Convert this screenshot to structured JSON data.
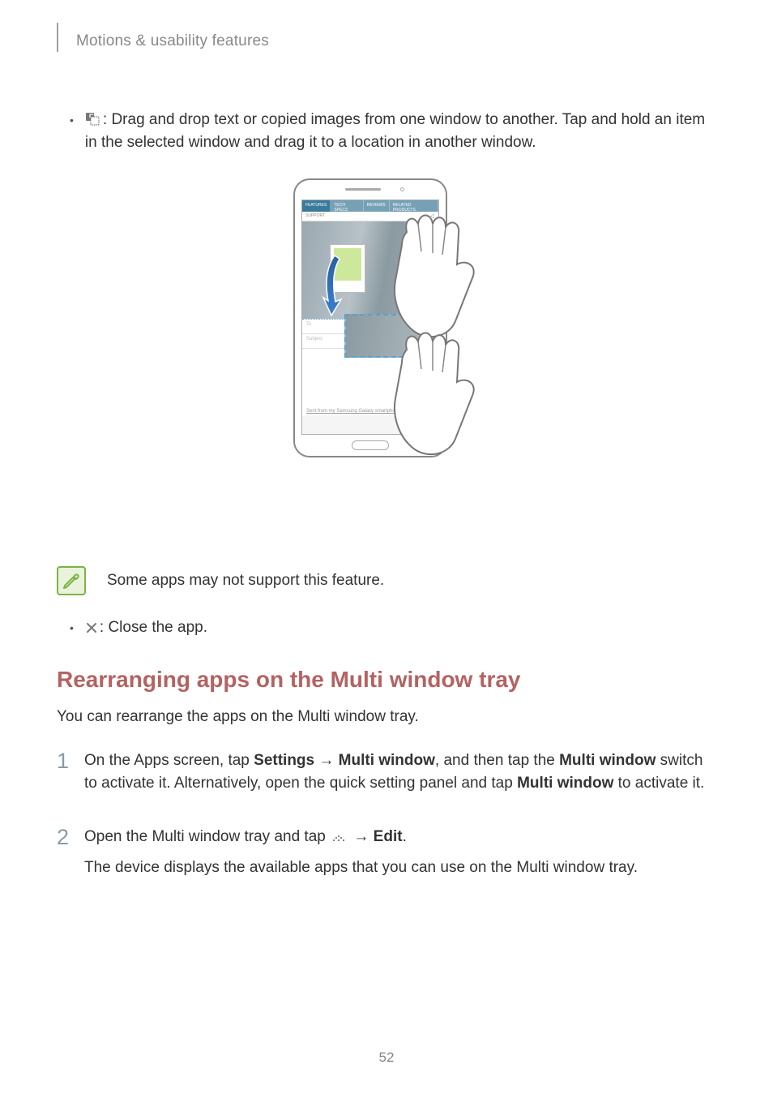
{
  "header": {
    "section": "Motions & usability features"
  },
  "bullets": {
    "drag": {
      "text": ": Drag and drop text or copied images from one window to another. Tap and hold an item in the selected window and drag it to a location in another window."
    },
    "close": {
      "text": ": Close the app."
    }
  },
  "callout": {
    "text": "Some apps may not support this feature."
  },
  "section": {
    "heading": "Rearranging apps on the Multi window tray",
    "intro": "You can rearrange the apps on the Multi window tray."
  },
  "steps": {
    "s1": {
      "num": "1",
      "pre": "On the Apps screen, tap ",
      "settings": "Settings",
      "arrow1": " → ",
      "mw": "Multi window",
      "mid": ", and then tap the ",
      "mw_sw": "Multi window",
      "post": " switch to activate it. Alternatively, open the quick setting panel and tap ",
      "mw_sw2": "Multi window",
      "end": " to activate it."
    },
    "s2": {
      "num": "2",
      "pre": "Open the Multi window tray and tap ",
      "arrow": " → ",
      "edit": "Edit",
      "period": ".",
      "line2": "The device displays the available apps that you can use on the Multi window tray."
    }
  },
  "figure": {
    "tabs": [
      "FEATURES",
      "TECH SPECS",
      "REVIEWS",
      "RELATED PRODUCTS"
    ],
    "support": "SUPPORT",
    "to": "To",
    "subject": "Subject",
    "sent": "Sent from my Samsung Galaxy smartphone"
  },
  "page": "52"
}
